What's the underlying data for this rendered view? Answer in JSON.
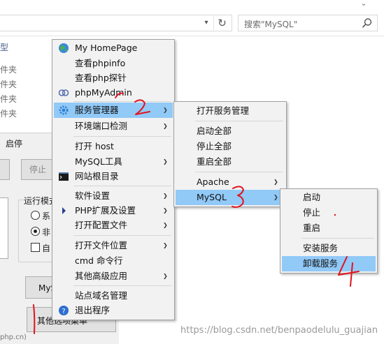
{
  "explorer": {
    "search_placeholder": "搜索\"MySQL\"",
    "column_type": "型",
    "file_types": [
      "件夹",
      "件夹",
      "件夹",
      "件夹"
    ]
  },
  "panel": {
    "title": "启停",
    "stop_button": "停止",
    "mode_label": "运行模式",
    "radio_1": "系",
    "radio_2": "非",
    "check_label": "自",
    "mys_button": "MyS",
    "other_button": "其他选项菜单",
    "footer": "php.cn)"
  },
  "main_menu": {
    "items": [
      {
        "label": "My HomePage",
        "icon": "globe-icon"
      },
      {
        "label": "查看phpinfo"
      },
      {
        "label": "查看php探针"
      },
      {
        "label": "phpMyAdmin",
        "icon": "rings-icon"
      },
      {
        "label": "服务管理器",
        "icon": "gear-icon"
      },
      {
        "label": "环境端口检测"
      },
      {
        "label": "打开 host"
      },
      {
        "label": "MySQL工具"
      },
      {
        "label": "网站根目录",
        "icon": "console-icon"
      },
      {
        "label": "软件设置"
      },
      {
        "label": "PHP扩展及设置",
        "icon": "triangle-icon"
      },
      {
        "label": "打开配置文件"
      },
      {
        "label": "打开文件位置"
      },
      {
        "label": "cmd 命令行"
      },
      {
        "label": "其他高级应用"
      },
      {
        "label": "站点域名管理"
      },
      {
        "label": "退出程序",
        "icon": "help-icon"
      }
    ]
  },
  "service_menu": {
    "items": [
      {
        "label": "打开服务管理"
      },
      {
        "label": "启动全部"
      },
      {
        "label": "停止全部"
      },
      {
        "label": "重启全部"
      },
      {
        "label": "Apache"
      },
      {
        "label": "MySQL"
      }
    ]
  },
  "mysql_menu": {
    "items": [
      {
        "label": "启动"
      },
      {
        "label": "停止"
      },
      {
        "label": "重启"
      },
      {
        "label": "安装服务"
      },
      {
        "label": "卸载服务"
      }
    ]
  },
  "watermark": "https://blog.csdn.net/benpaodelulu_guajian",
  "colors": {
    "highlight": "#91c9f7",
    "menu_bg": "#f2f2f2",
    "annotation_red": "#e0141e"
  }
}
